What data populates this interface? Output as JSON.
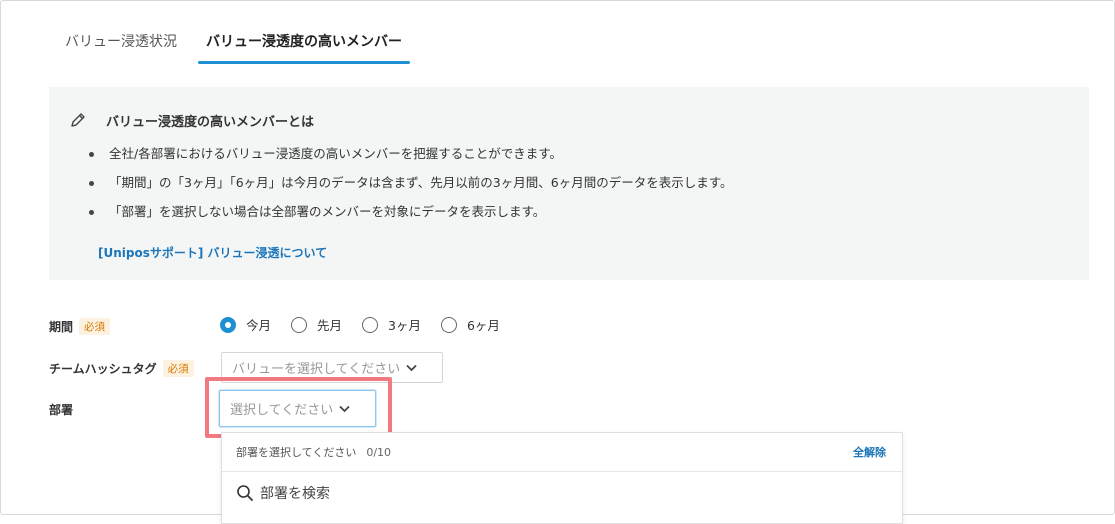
{
  "tabs": [
    {
      "label": "バリュー浸透状況",
      "active": false
    },
    {
      "label": "バリュー浸透度の高いメンバー",
      "active": true
    }
  ],
  "info": {
    "icon": "pencil-icon",
    "title": "バリュー浸透度の高いメンバーとは",
    "bullets": [
      "全社/各部署におけるバリュー浸透度の高いメンバーを把握することができます。",
      "「期間」の「3ヶ月」「6ヶ月」は今月のデータは含まず、先月以前の3ヶ月間、6ヶ月間のデータを表示します。",
      "「部署」を選択しない場合は全部署のメンバーを対象にデータを表示します。"
    ],
    "link": "[Uniposサポート] バリュー浸透について"
  },
  "form": {
    "period": {
      "label": "期間",
      "required": "必須",
      "options": [
        "今月",
        "先月",
        "3ヶ月",
        "6ヶ月"
      ],
      "selected": "今月"
    },
    "hashtag": {
      "label": "チームハッシュタグ",
      "required": "必須",
      "placeholder": "バリューを選択してください"
    },
    "department": {
      "label": "部署",
      "placeholder": "選択してください"
    }
  },
  "dropdown": {
    "header": "部署を選択してください",
    "count": "0/10",
    "clear": "全解除",
    "search_placeholder": "部署を検索"
  },
  "colors": {
    "accent": "#1e8fd0",
    "link": "#1c76b9",
    "required": "#d47a00",
    "highlight": "#f07a80"
  }
}
